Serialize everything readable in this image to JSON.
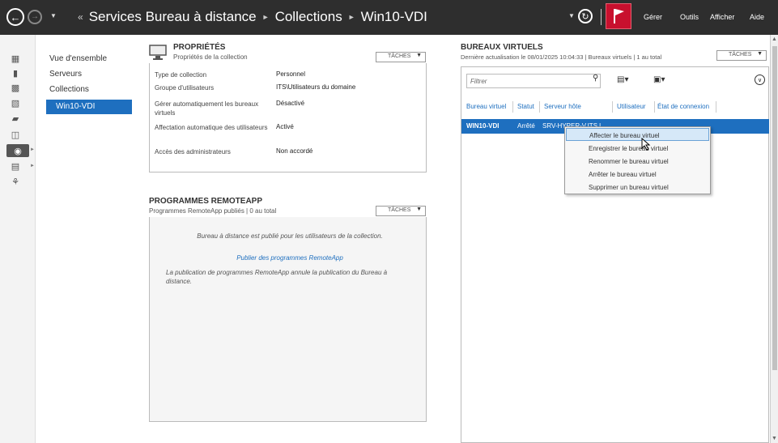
{
  "titlebar": {
    "breadcrumb_lead": "«",
    "crumbs": [
      "Services Bureau à distance",
      "Collections",
      "Win10-VDI"
    ],
    "menu": [
      "Gérer",
      "Outils",
      "Afficher",
      "Aide"
    ],
    "flag_color": "#c8102e"
  },
  "nav": {
    "items": [
      "Vue d'ensemble",
      "Serveurs",
      "Collections"
    ],
    "selected": "Win10-VDI",
    "accent": "#1e6fbf"
  },
  "properties": {
    "title": "PROPRIÉTÉS",
    "subtitle": "Propriétés de la collection",
    "tasks": "TÂCHES",
    "rows": [
      {
        "label": "Type de collection",
        "value": "Personnel"
      },
      {
        "label": "Groupe d'utilisateurs",
        "value": "ITS\\Utilisateurs du domaine"
      },
      {
        "label": "Gérer automatiquement les bureaux virtuels",
        "value": "Désactivé"
      },
      {
        "label": "Affectation automatique des utilisateurs",
        "value": "Activé"
      },
      {
        "label": "Accès des administrateurs",
        "value": "Non accordé"
      }
    ]
  },
  "remoteapp": {
    "title": "PROGRAMMES REMOTEAPP",
    "subtitle": "Programmes RemoteApp publiés | 0 au total",
    "tasks": "TÂCHES",
    "info": "Bureau à distance est publié pour les utilisateurs de la collection.",
    "link": "Publier des programmes RemoteApp",
    "note": "La publication de programmes RemoteApp annule la publication du Bureau à distance."
  },
  "virtual_desktops": {
    "title": "BUREAUX VIRTUELS",
    "subtitle": "Dernière actualisation le 08/01/2025 10:04:33 | Bureaux virtuels | 1 au total",
    "tasks": "TÂCHES",
    "filter_placeholder": "Filtrer",
    "columns": [
      "Bureau virtuel",
      "Statut",
      "Serveur hôte",
      "Utilisateur",
      "État de connexion"
    ],
    "rows": [
      {
        "name": "WIN10-VDI",
        "status": "Arrêté",
        "host": "SRV-HYPER-V.ITS.l..."
      }
    ]
  },
  "context_menu": {
    "items": [
      "Affecter le bureau virtuel",
      "Enregistrer le bureau virtuel",
      "Renommer le bureau virtuel",
      "Arrêter le bureau virtuel",
      "Supprimer un bureau virtuel"
    ],
    "hovered_index": 0
  }
}
